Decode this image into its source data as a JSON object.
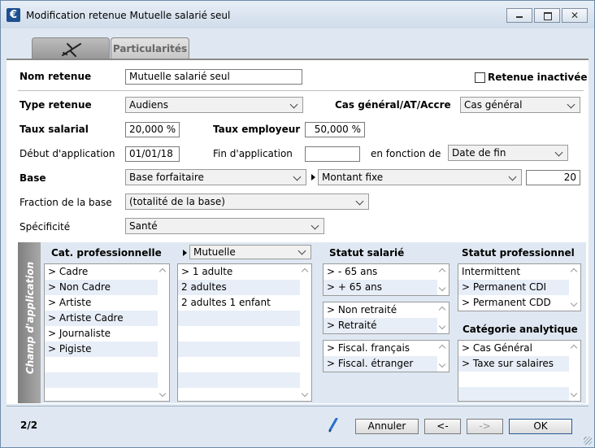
{
  "window": {
    "title": "Modification retenue Mutuelle salarié seul",
    "app_icon_glyph": "€",
    "close_glyph": "✕"
  },
  "tabs": [
    {
      "icon": "plane-icon"
    },
    {
      "label": "Particularités"
    }
  ],
  "form": {
    "nom_retenue_label": "Nom retenue",
    "nom_retenue_value": "Mutuelle salarié seul",
    "retenue_inactivee_label": "Retenue inactivée",
    "retenue_inactivee_checked": false,
    "type_retenue_label": "Type retenue",
    "type_retenue_value": "Audiens",
    "cas_general_label": "Cas général/AT/Accre",
    "cas_general_value": "Cas général",
    "taux_salarial_label": "Taux salarial",
    "taux_salarial_value": "20,000 %",
    "taux_employeur_label": "Taux employeur",
    "taux_employeur_value": "50,000 %",
    "debut_label": "Début d'application",
    "debut_value": "01/01/18",
    "fin_label": "Fin d'application",
    "fin_value": "",
    "en_fonction_label": "en fonction de",
    "en_fonction_value": "Date de fin",
    "base_label": "Base",
    "base_value": "Base forfaitaire",
    "montant_value": "Montant fixe",
    "montant_number": "20",
    "fraction_label": "Fraction de la base",
    "fraction_value": "(totalité de la base)",
    "specificite_label": "Spécificité",
    "specificite_value": "Santé"
  },
  "scope": {
    "side_label": "Champ d'application",
    "cat_pro": {
      "header": "Cat. professionnelle",
      "items": [
        "> Cadre",
        "> Non Cadre",
        "> Artiste",
        "> Artiste Cadre",
        "> Journaliste",
        "> Pigiste"
      ]
    },
    "mutuelle": {
      "select_value": "Mutuelle",
      "items": [
        "> 1 adulte",
        "2 adultes",
        "2 adultes 1 enfant"
      ]
    },
    "statut_salarie": {
      "header": "Statut salarié",
      "age_items": [
        ">  - 65 ans",
        ">  + 65 ans"
      ],
      "retraite_items": [
        "> Non retraité",
        "> Retraité"
      ],
      "fiscal_items": [
        "> Fiscal. français",
        "> Fiscal. étranger"
      ]
    },
    "statut_pro": {
      "header": "Statut professionnel",
      "items": [
        "Intermittent",
        "> Permanent CDI",
        "> Permanent CDD"
      ]
    },
    "categorie_analytique": {
      "header": "Catégorie analytique",
      "items": [
        "> Cas Général",
        "> Taxe sur salaires"
      ]
    }
  },
  "footer": {
    "pager": "2/2",
    "annuler": "Annuler",
    "prev": "<-",
    "next": "->",
    "ok": "OK"
  }
}
